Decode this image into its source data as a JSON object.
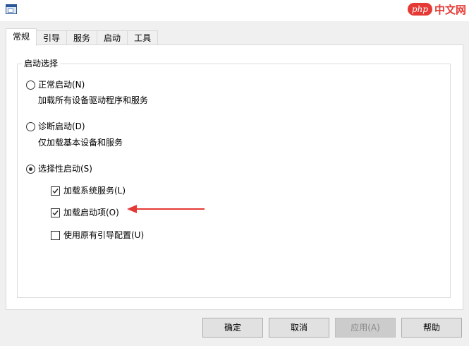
{
  "tabs": [
    "常规",
    "引导",
    "服务",
    "启动",
    "工具"
  ],
  "watermark": {
    "brand": "php",
    "text": "中文网"
  },
  "group": {
    "legend": "启动选择",
    "normal": {
      "label": "正常启动(N)",
      "desc": "加载所有设备驱动程序和服务",
      "selected": false
    },
    "diagnostic": {
      "label": "诊断启动(D)",
      "desc": "仅加载基本设备和服务",
      "selected": false
    },
    "selective": {
      "label": "选择性启动(S)",
      "selected": true,
      "options": [
        {
          "label": "加载系统服务(L)",
          "checked": true
        },
        {
          "label": "加载启动项(O)",
          "checked": true
        },
        {
          "label": "使用原有引导配置(U)",
          "checked": false
        }
      ]
    }
  },
  "buttons": {
    "ok": "确定",
    "cancel": "取消",
    "apply": "应用(A)",
    "help": "帮助"
  },
  "colors": {
    "annotation_arrow": "#e53935"
  },
  "icons": {
    "app": "system-config-icon",
    "arrow": "red-arrow-pointer-icon"
  }
}
